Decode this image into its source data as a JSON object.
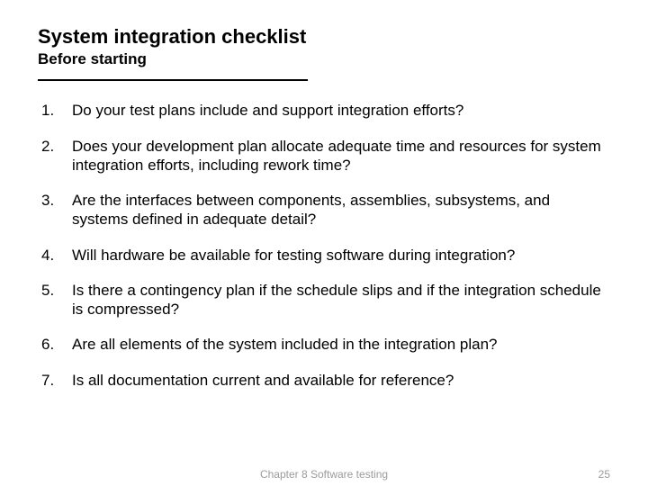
{
  "title": "System integration checklist",
  "subtitle": "Before starting",
  "items": [
    "Do your test plans include and support integration efforts?",
    "Does your development plan allocate adequate time and resources for system integration efforts, including rework time?",
    "Are the interfaces between components, assemblies, subsystems, and systems defined in adequate detail?",
    "Will hardware be available for testing software during integration?",
    "Is there a contingency plan if the schedule slips and if the integration schedule is compressed?",
    "Are all elements of the system included in the integration plan?",
    "Is all documentation current and available for reference?"
  ],
  "footer": {
    "center": "Chapter 8 Software testing",
    "page": "25"
  }
}
